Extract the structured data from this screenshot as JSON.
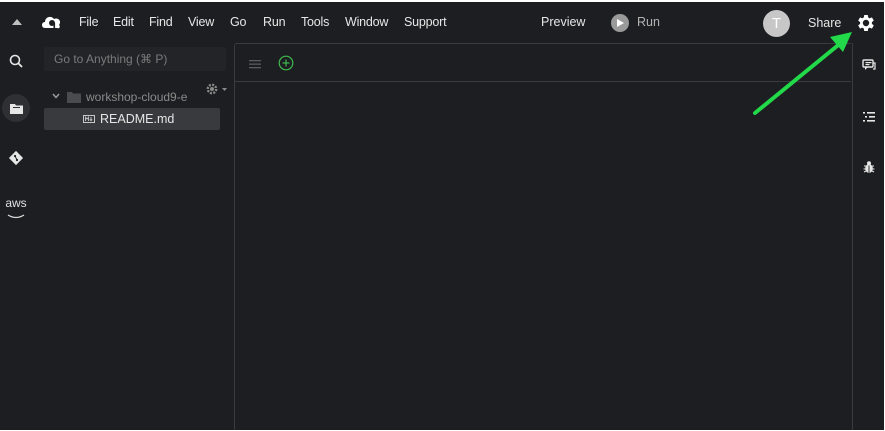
{
  "menubar": {
    "items": [
      "File",
      "Edit",
      "Find",
      "View",
      "Go",
      "Run",
      "Tools",
      "Window",
      "Support"
    ],
    "preview_label": "Preview",
    "run_label": "Run",
    "avatar_initial": "T",
    "share_label": "Share"
  },
  "left_rail": {
    "aws_label": "aws"
  },
  "file_tree": {
    "goto_placeholder": "Go to Anything (⌘ P)",
    "folder_name": "workshop-cloud9-e",
    "file_name": "README.md"
  },
  "colors": {
    "background": "#1d1e21",
    "selected_row": "#393a3d",
    "add_icon": "#3fb950",
    "annotation_arrow": "#22d94a"
  }
}
